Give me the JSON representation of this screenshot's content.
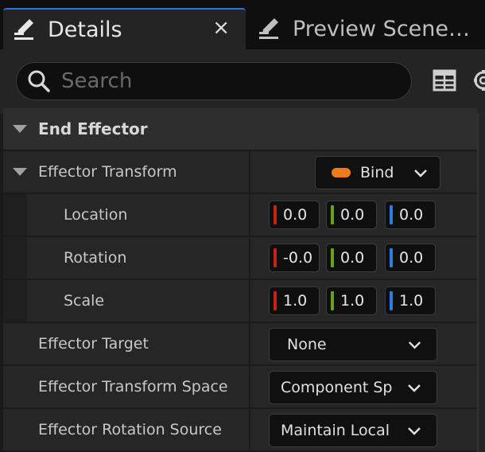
{
  "tabs": [
    {
      "label": "Details",
      "active": true,
      "icon": "edit-list-icon",
      "close": "×"
    },
    {
      "label": "Preview Scene…",
      "active": false,
      "icon": "edit-list-icon"
    }
  ],
  "search": {
    "placeholder": "Search",
    "value": ""
  },
  "toolbar": {
    "icons": [
      "table-view-icon",
      "gear-icon"
    ]
  },
  "section": {
    "title": "End Effector"
  },
  "colors": {
    "x_axis": "#c4250f",
    "y_axis": "#6aa01b",
    "z_axis": "#2f7de0",
    "bind_dot": "#f07a1a",
    "tab_accent": "#2f6fd6"
  },
  "rows": {
    "effector_transform": {
      "label": "Effector Transform",
      "bind_label": "Bind"
    },
    "location": {
      "label": "Location",
      "x": "0.0",
      "y": "0.0",
      "z": "0.0"
    },
    "rotation": {
      "label": "Rotation",
      "x": "-0.0",
      "y": "0.0",
      "z": "0.0"
    },
    "scale": {
      "label": "Scale",
      "x": "1.0",
      "y": "1.0",
      "z": "1.0"
    },
    "effector_target": {
      "label": "Effector Target",
      "value": "None"
    },
    "effector_transform_space": {
      "label": "Effector Transform Space",
      "value": "Component Sp"
    },
    "effector_rotation_source": {
      "label": "Effector Rotation Source",
      "value": "Maintain Local"
    }
  }
}
